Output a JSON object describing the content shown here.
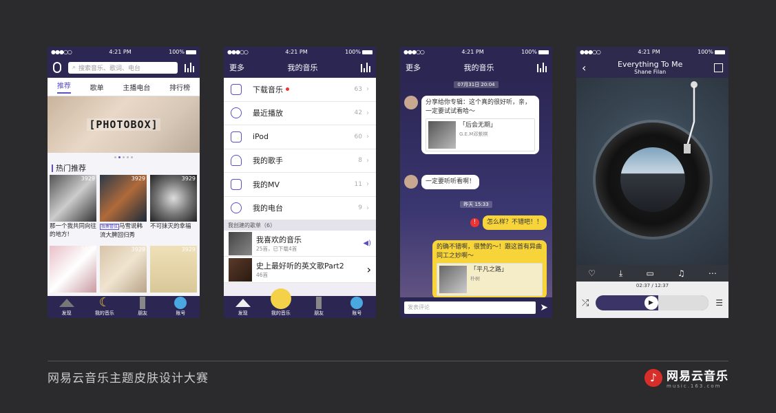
{
  "status": {
    "time": "4:21 PM",
    "battery": "100%",
    "signal": "●●●○○"
  },
  "screen1": {
    "search_placeholder": "搜索音乐、歌词、电台",
    "tabs": [
      "推荐",
      "歌单",
      "主播电台",
      "排行榜"
    ],
    "banner_text": "[PHOTOBOX]",
    "section": "热门推荐",
    "cards": [
      {
        "count": "3929",
        "caption": "那一个我共同向往的地方!"
      },
      {
        "count": "3929",
        "tag": "独奏管弦",
        "caption": "马雪说韩流大脾回归秀"
      },
      {
        "count": "3929",
        "caption": "不可抹灭的幸福"
      },
      {
        "count": "3929",
        "caption": ""
      },
      {
        "count": "3929",
        "caption": ""
      },
      {
        "count": "3929",
        "caption": ""
      }
    ],
    "tabbar": [
      "发现",
      "我的音乐",
      "朋友",
      "账号"
    ]
  },
  "screen2": {
    "left": "更多",
    "title": "我的音乐",
    "rows": [
      {
        "label": "下载音乐",
        "count": "63",
        "dot": true
      },
      {
        "label": "最近播放",
        "count": "42"
      },
      {
        "label": "iPod",
        "count": "60"
      },
      {
        "label": "我的歌手",
        "count": "8"
      },
      {
        "label": "我的MV",
        "count": "11"
      },
      {
        "label": "我的电台",
        "count": "9"
      }
    ],
    "subhead": "我创建的歌单（6）",
    "playlists": [
      {
        "name": "我喜欢的音乐",
        "sub": "25首，已下载4首"
      },
      {
        "name": "史上最好听的英文歌Part2",
        "sub": "46首"
      }
    ],
    "tabbar": [
      "发现",
      "我的音乐",
      "朋友",
      "账号"
    ]
  },
  "screen3": {
    "left": "更多",
    "title": "我的音乐",
    "ts1": "07月31日 20:04",
    "msg1": "分享给你专辑：这个真的很好听，亲，一定要试试看哈～",
    "share1": {
      "title": "「后会无期」",
      "sub": "G.E.M邓紫棋"
    },
    "msg2": "一定要听听看啊！",
    "ts2": "昨天 15:33",
    "msg3": "怎么样？不错吧！！",
    "msg4": "的确不错啊，很赞的～！跟这首有异曲同工之妙啊～",
    "share2": {
      "title": "「平凡之路」",
      "sub": "朴树"
    },
    "comment_placeholder": "发表评论"
  },
  "screen4": {
    "song": "Everything To Me",
    "artist": "Shane Filan",
    "time": "02:37 / 12:37",
    "progress": 0.55
  },
  "footer": {
    "title": "网易云音乐主题皮肤设计大赛",
    "logo_name": "网易云音乐",
    "logo_url": "music.163.com"
  },
  "colors": {
    "accent": "#5a4fc5",
    "navy": "#2b2652",
    "yellow": "#f7d43a",
    "bg": "#2b2b2e"
  }
}
